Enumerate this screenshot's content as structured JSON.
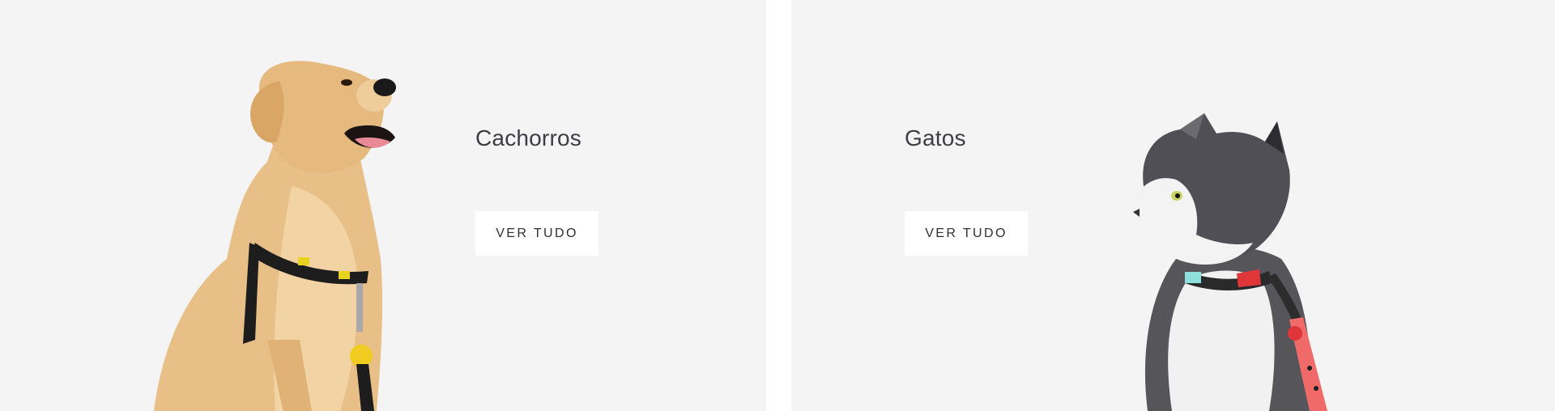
{
  "categories": [
    {
      "title": "Cachorros",
      "button_label": "VER TUDO",
      "image": "dog-photo"
    },
    {
      "title": "Gatos",
      "button_label": "VER TUDO",
      "image": "cat-photo"
    }
  ],
  "colors": {
    "panel_bg": "#f4f4f4",
    "title_text": "#3d3d44",
    "button_bg": "#ffffff",
    "button_text": "#2f2f35"
  }
}
